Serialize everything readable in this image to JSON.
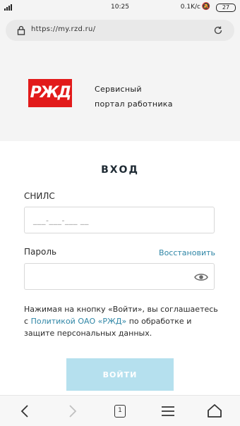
{
  "status_bar": {
    "time": "10:25",
    "network_speed": "0.1K/c",
    "battery_level": "27"
  },
  "browser": {
    "url": "https://my.rzd.ru/",
    "tab_count": "1"
  },
  "header": {
    "logo_text": "РЖД",
    "portal_title_line1": "Сервисный",
    "portal_title_line2": "портал работника",
    "brand_color": "#e21a1a"
  },
  "login": {
    "title": "ВХОД",
    "snils_label": "СНИЛС",
    "snils_placeholder": "___-___-___ __",
    "password_label": "Пароль",
    "restore_link": "Восстановить",
    "agreement_prefix": "Нажимая на кнопку «Войти», вы соглашаетесь с",
    "agreement_policy_link": "Политикой ОАО «РЖД»",
    "agreement_suffix": "по обработке и защите персональных данных.",
    "submit_label": "ВОЙТИ",
    "accent_color": "#2f86a6",
    "submit_color": "#b5e0ee"
  },
  "icons": {
    "lock": "lock-icon",
    "reload": "reload-icon",
    "eye": "eye-icon",
    "back": "back-arrow-icon",
    "forward": "forward-arrow-icon",
    "menu": "menu-icon",
    "home": "home-icon"
  }
}
